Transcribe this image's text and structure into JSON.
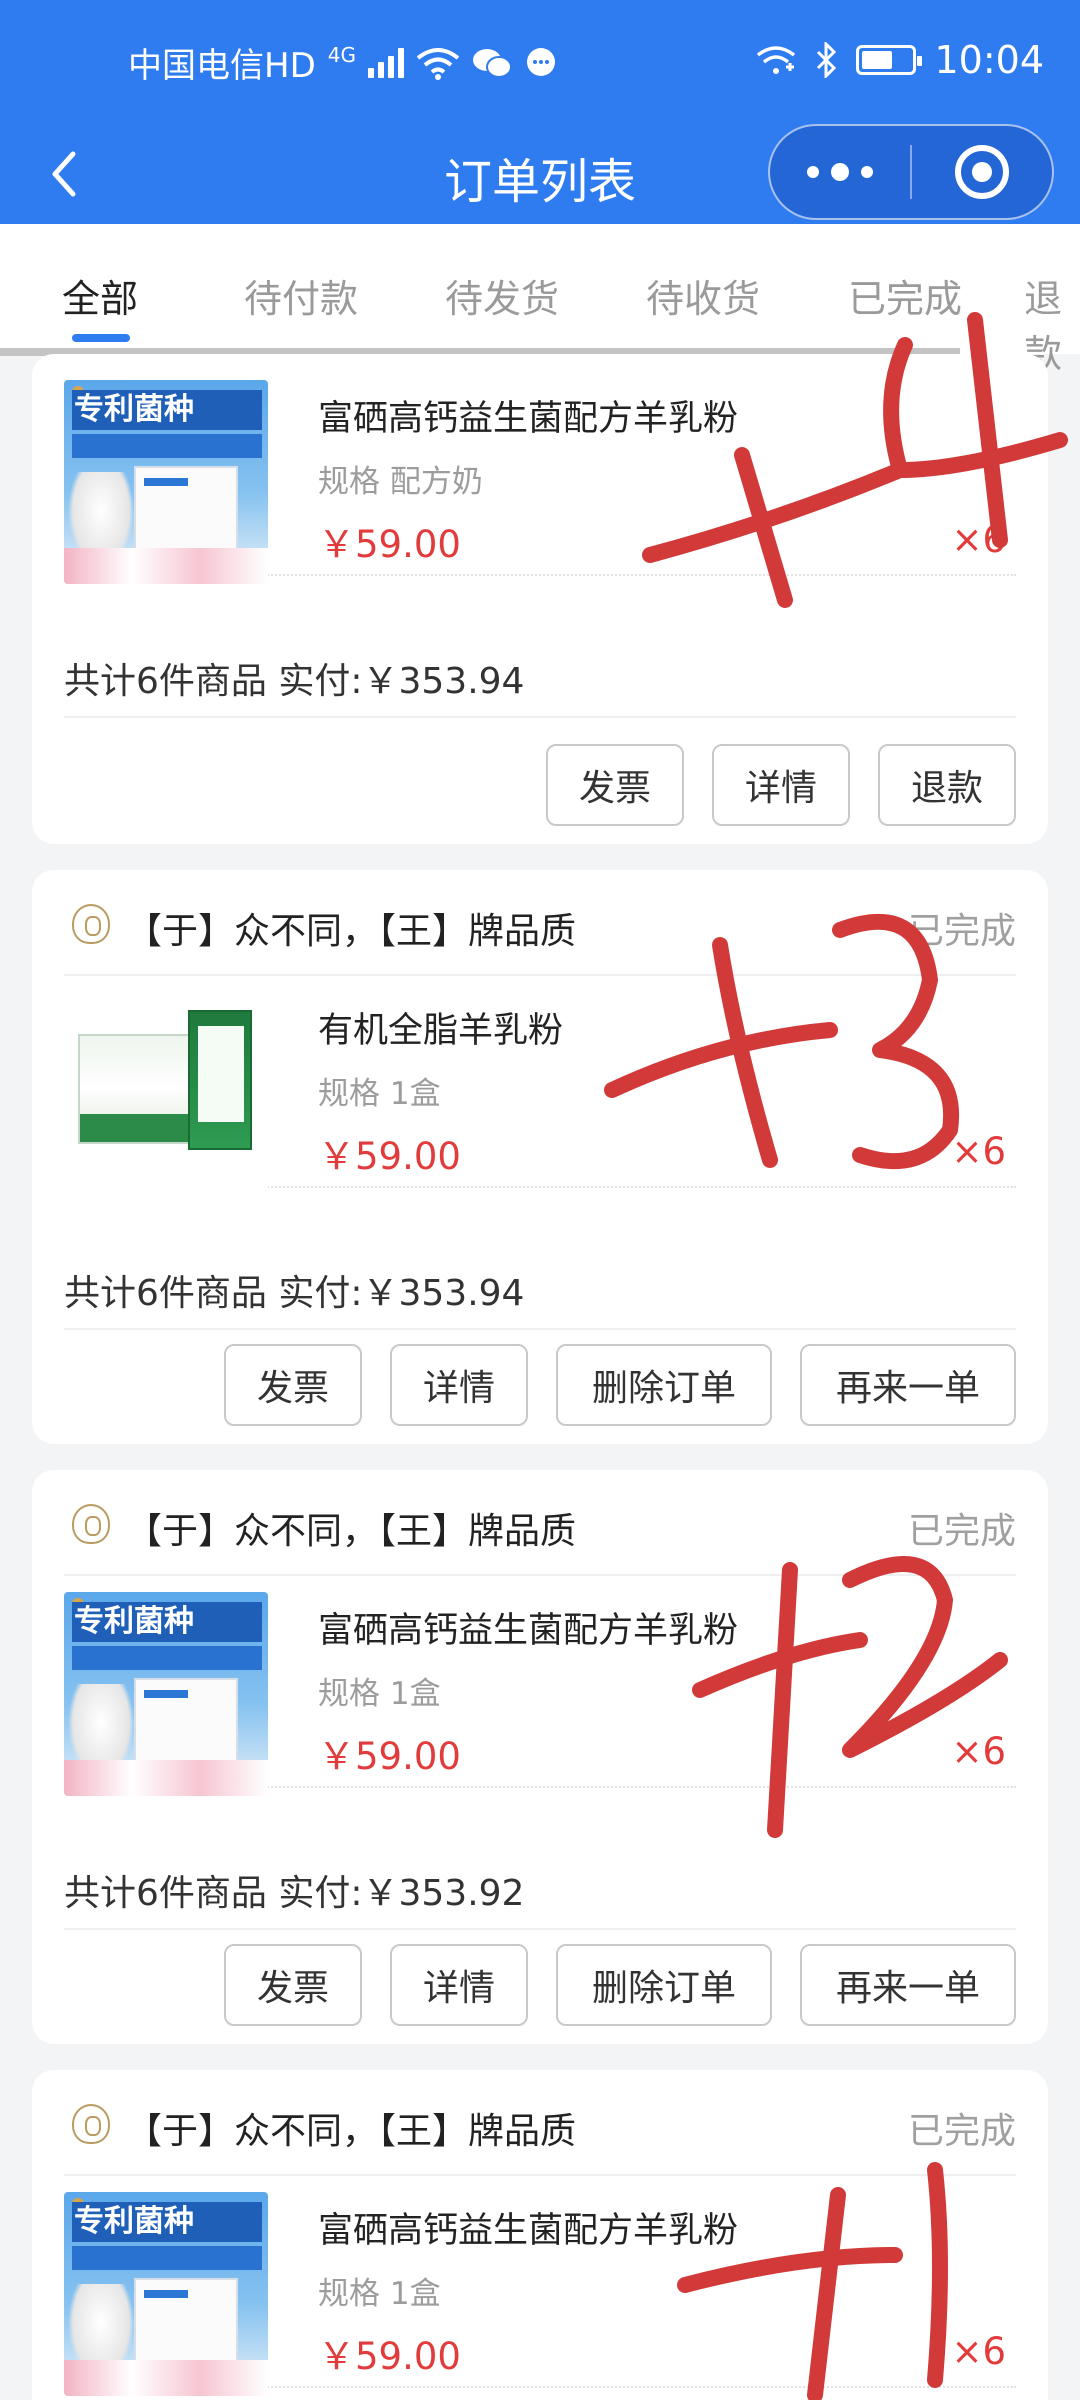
{
  "status_bar": {
    "carrier": "中国电信HD",
    "network": "4G",
    "time": "10:04"
  },
  "nav": {
    "title": "订单列表"
  },
  "tabs": [
    {
      "label": "全部",
      "active": true
    },
    {
      "label": "待付款",
      "active": false
    },
    {
      "label": "待发货",
      "active": false
    },
    {
      "label": "待收货",
      "active": false
    },
    {
      "label": "已完成",
      "active": false
    },
    {
      "label": "退款",
      "active": false
    }
  ],
  "orders": [
    {
      "store": "",
      "status": "",
      "product_name": "富硒高钙益生菌配方羊乳粉",
      "spec": "规格 配方奶",
      "price": "￥59.00",
      "qty": "×6",
      "total": "共计6件商品 实付:￥353.94",
      "buttons": [
        "发票",
        "详情",
        "退款"
      ]
    },
    {
      "store": "【于】众不同，【王】牌品质",
      "status": "已完成",
      "product_name": "有机全脂羊乳粉",
      "spec": "规格 1盒",
      "price": "￥59.00",
      "qty": "×6",
      "total": "共计6件商品 实付:￥353.94",
      "buttons": [
        "发票",
        "详情",
        "删除订单",
        "再来一单"
      ]
    },
    {
      "store": "【于】众不同，【王】牌品质",
      "status": "已完成",
      "product_name": "富硒高钙益生菌配方羊乳粉",
      "spec": "规格 1盒",
      "price": "￥59.00",
      "qty": "×6",
      "total": "共计6件商品 实付:￥353.92",
      "buttons": [
        "发票",
        "详情",
        "删除订单",
        "再来一单"
      ]
    },
    {
      "store": "【于】众不同，【王】牌品质",
      "status": "已完成",
      "product_name": "富硒高钙益生菌配方羊乳粉",
      "spec": "规格 1盒",
      "price": "￥59.00",
      "qty": "×6"
    }
  ],
  "image_text": {
    "brand_banner": "专利菌种"
  },
  "colors": {
    "header_blue": "#2f7bf0",
    "price_red": "#e23b3b",
    "ink_red": "#d23a3a"
  }
}
